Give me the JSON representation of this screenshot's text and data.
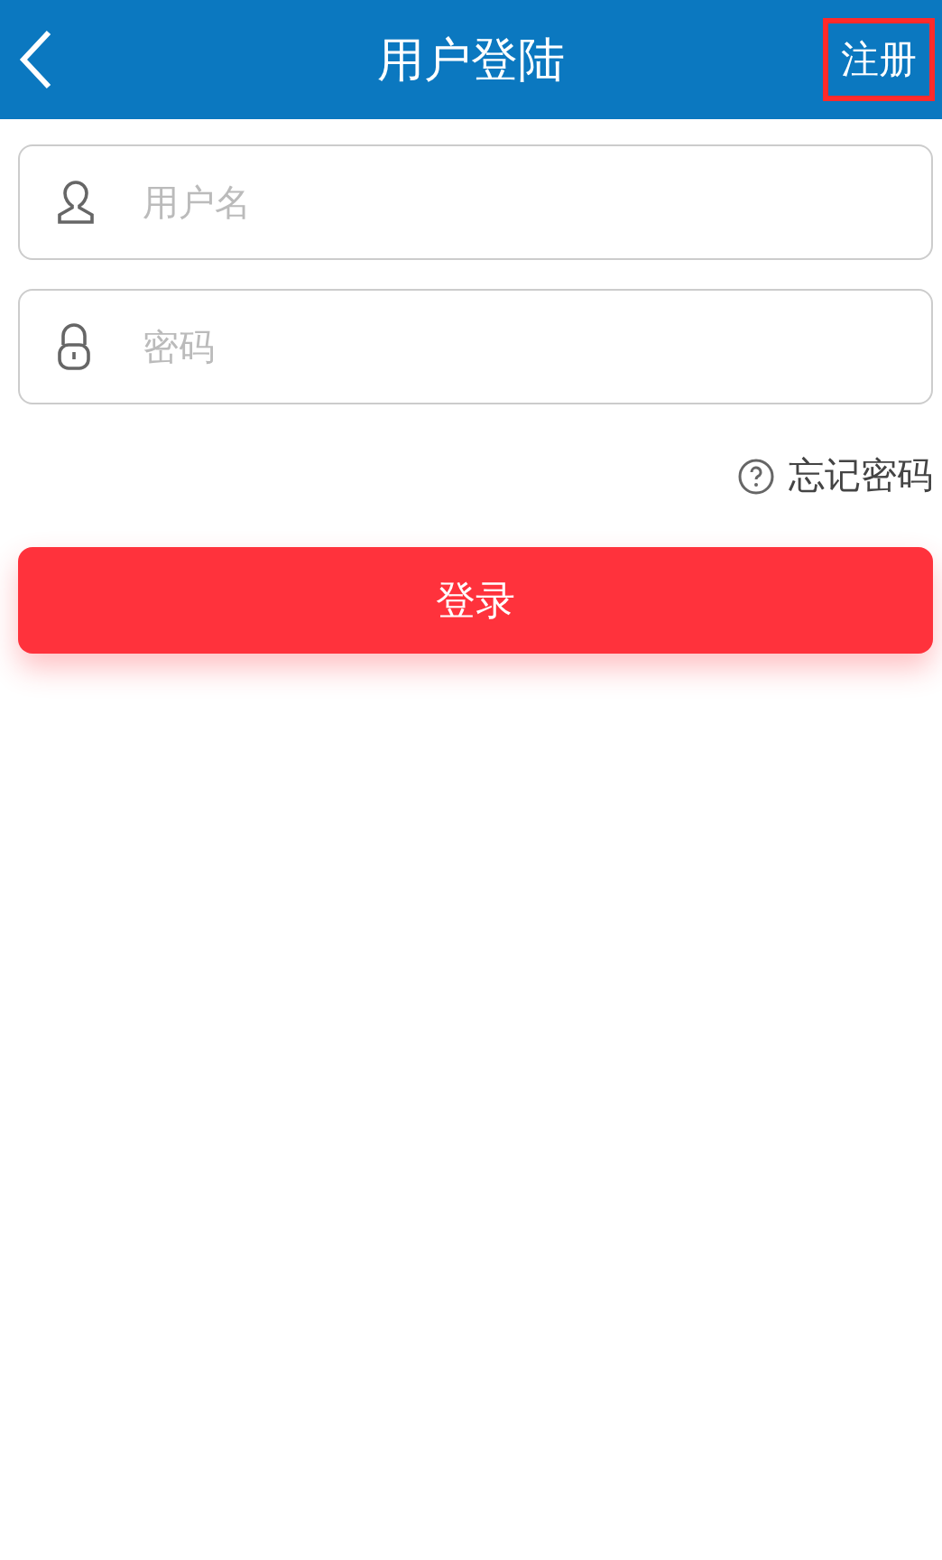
{
  "header": {
    "title": "用户登陆",
    "action": {
      "label": "注册",
      "highlighted": true
    }
  },
  "fields": [
    {
      "kind": "user",
      "placeholder": "用户名"
    },
    {
      "kind": "lock",
      "placeholder": "密码"
    }
  ],
  "forgot_link": {
    "label": "忘记密码"
  },
  "login_button": {
    "label": "登录"
  }
}
